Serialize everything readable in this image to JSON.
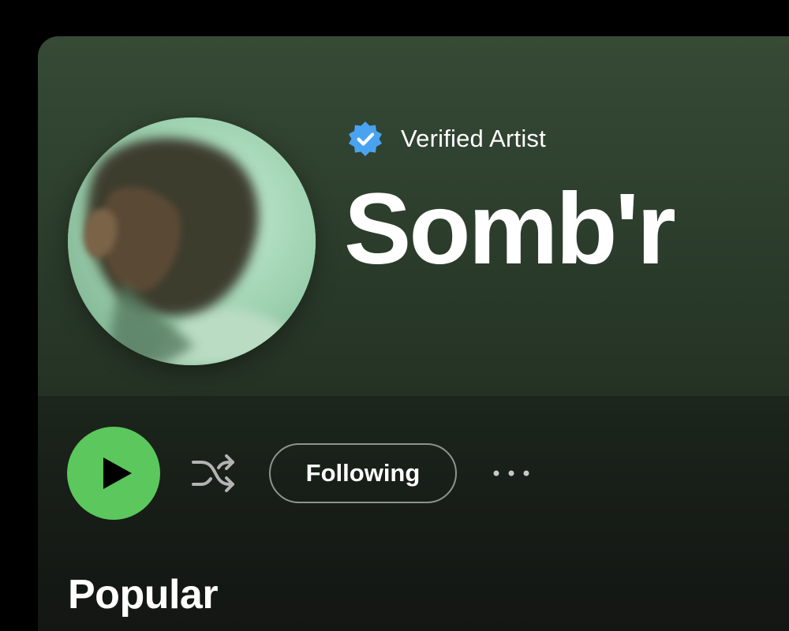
{
  "artist": {
    "verified_label": "Verified Artist",
    "name": "Somb'r"
  },
  "actions": {
    "play_icon": "play-icon",
    "shuffle_icon": "shuffle-icon",
    "follow_label": "Following",
    "more_icon": "more-options-icon"
  },
  "sections": {
    "popular_title": "Popular"
  },
  "colors": {
    "accent_green": "#5cc75c",
    "verified_badge": "#4aa3f0",
    "header_bg": "#364a36",
    "text_primary": "#ffffff"
  }
}
